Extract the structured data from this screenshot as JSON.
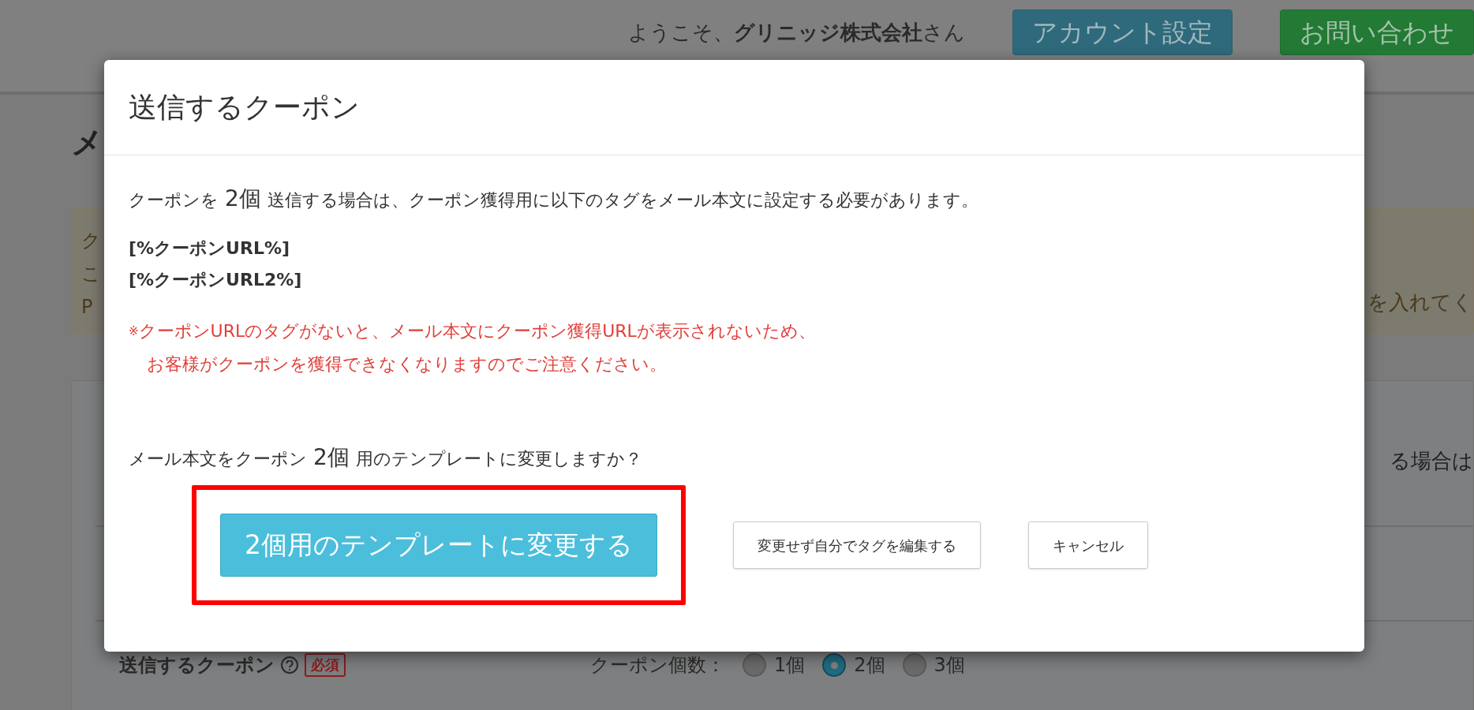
{
  "header": {
    "welcome": {
      "prefix": "ようこそ、",
      "company": "グリニッジ株式会社",
      "suffix": "さん"
    },
    "buttons": [
      {
        "label": "アカウント設定",
        "kind": "info"
      },
      {
        "label": "お問い合わせ",
        "kind": "success"
      }
    ]
  },
  "page": {
    "title": "メ",
    "alert": {
      "left_lines": [
        "ク",
        "こ",
        "P"
      ],
      "right_text": "を入れてく"
    },
    "card": {
      "right_text": "る場合は",
      "field": {
        "label": "送信するクーポン",
        "required_badge": "必須",
        "count_label": "クーポン個数：",
        "options": [
          {
            "label": "1個",
            "selected": false
          },
          {
            "label": "2個",
            "selected": true
          },
          {
            "label": "3個",
            "selected": false
          }
        ]
      }
    }
  },
  "modal": {
    "title": "送信するクーポン",
    "message": {
      "before": "クーポンを",
      "count": "2個",
      "after": "送信する場合は、クーポン獲得用に以下のタグをメール本文に設定する必要があります。"
    },
    "tags": [
      "[%クーポンURL%]",
      "[%クーポンURL2%]"
    ],
    "warning": {
      "mark": "※",
      "lines": [
        "クーポンURLのタグがないと、メール本文にクーポン獲得URLが表示されないため、",
        "お客様がクーポンを獲得できなくなりますのでご注意ください。"
      ]
    },
    "question": {
      "before": "メール本文をクーポン",
      "count": "2個",
      "after": "用のテンプレートに変更しますか？"
    },
    "buttons": [
      {
        "label": "2個用のテンプレートに変更する",
        "kind": "primary",
        "highlighted": true
      },
      {
        "label": "変更せず自分でタグを編集する",
        "kind": "default",
        "highlighted": false
      },
      {
        "label": "キャンセル",
        "kind": "default",
        "highlighted": false
      }
    ]
  }
}
